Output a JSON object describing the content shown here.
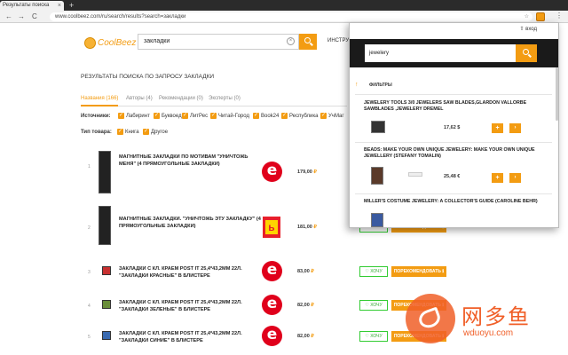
{
  "browser": {
    "tab_title": "Результаты поиска",
    "tab_close": "×",
    "new_tab": "+",
    "url": "www.coolbeez.com/ru/search/results?search=закладки",
    "back": "←",
    "forward": "→",
    "reload": "C",
    "star": "☆",
    "menu": "⋮"
  },
  "site": {
    "logo": "CoolBeez",
    "search_value": "закладки",
    "clear": "×",
    "instruments_label": "ИНСТРУМ",
    "results_title": "РЕЗУЛЬТАТЫ ПОИСКА ПО ЗАПРОСУ ЗАКЛАДКИ"
  },
  "result_tabs": [
    {
      "label": "Названия (166)",
      "active": true
    },
    {
      "label": "Авторы (4)"
    },
    {
      "label": "Рекомендации (0)"
    },
    {
      "label": "Эксперты (0)"
    }
  ],
  "filters": {
    "sources_label": "Источники:",
    "sources": [
      "Лабиринт",
      "Буквоед",
      "ЛитРес",
      "Читай-Город",
      "Book24",
      "Республика",
      "УчМаг"
    ],
    "check": "✓",
    "type_label": "Тип товара:",
    "types": [
      "Книга",
      "Другое"
    ]
  },
  "results": [
    {
      "num": "1",
      "title": "МАГНИТНЫЕ ЗАКЛАДКИ ПО МОТИВАМ \"УНИЧТОЖЬ МЕНЯ\" (4 ПРЯМОУГОЛЬНЫЕ ЗАКЛАДКИ)",
      "shop": "e",
      "price": "179,00",
      "currency": "₽"
    },
    {
      "num": "2",
      "title": "МАГНИТНЫЕ ЗАКЛАДКИ. \"УНИЧТОЖЬ ЭТУ ЗАКЛАДКУ\" (4 ПРЯМОУГОЛЬНЫЕ ЗАКЛАДКИ)",
      "shop": "ь",
      "price": "181,00",
      "currency": "₽",
      "like": "♡ ХОЧУ",
      "recommend": "ПОРЕКОМЕНДОВАТЬ ℹ"
    },
    {
      "num": "3",
      "title": "ЗАКЛАДКИ С КЛ. КРАЕМ POST IT 25,4*43,2ММ 22Л. \"ЗАКЛАДКИ КРАСНЫЕ\" В БЛИСТЕРЕ",
      "shop": "e",
      "price": "83,00",
      "currency": "₽",
      "like": "♡ ХОЧУ",
      "recommend": "ПОРЕКОМЕНДОВАТЬ ℹ"
    },
    {
      "num": "4",
      "title": "ЗАКЛАДКИ С КЛ. КРАЕМ POST IT 25,4*43,2ММ 22Л. \"ЗАКЛАДКИ ЗЕЛЕНЫЕ\" В БЛИСТЕРЕ",
      "shop": "e",
      "price": "82,00",
      "currency": "₽",
      "like": "♡ ХОЧУ",
      "recommend": "ПОРЕКОМЕНДОВАТЬ ℹ"
    },
    {
      "num": "5",
      "title": "ЗАКЛАДКИ С КЛ. КРАЕМ POST IT 25,4*43,2ММ 22Л. \"ЗАКЛАДКИ СИНИЕ\" В БЛИСТЕРЕ",
      "shop": "e",
      "price": "82,00",
      "currency": "₽",
      "like": "♡ ХОЧУ",
      "recommend": "ПОРЕКОМЕНДОВАТЬ ℹ"
    }
  ],
  "popup": {
    "login": "⇧ вход",
    "search_value": "jewelery",
    "filters_arrow": "↑",
    "filters_label": "ФИЛЬТРЫ",
    "items": [
      {
        "title": "JEWELERY TOOLS 3/0 JEWELERS SAW BLADES,GLARDON VALLORBE SAWBLADES ,JEWELERY DREMEL",
        "price": "17,62 $",
        "plus": "+",
        "go": "›"
      },
      {
        "title": "BEADS: MAKE YOUR OWN UNIQUE JEWELERY: MAKE YOUR OWN UNIQUE JEWELLERY (STEFANY TOMALIN)",
        "price": "25,48 €",
        "plus": "+",
        "go": "›"
      },
      {
        "title": "MILLER'S COSTUME JEWELERY: A COLLECTOR'S GUIDE (CAROLINE BEHR)"
      }
    ]
  },
  "watermark": {
    "text": "网多鱼",
    "sub": "wduoyu.com"
  }
}
